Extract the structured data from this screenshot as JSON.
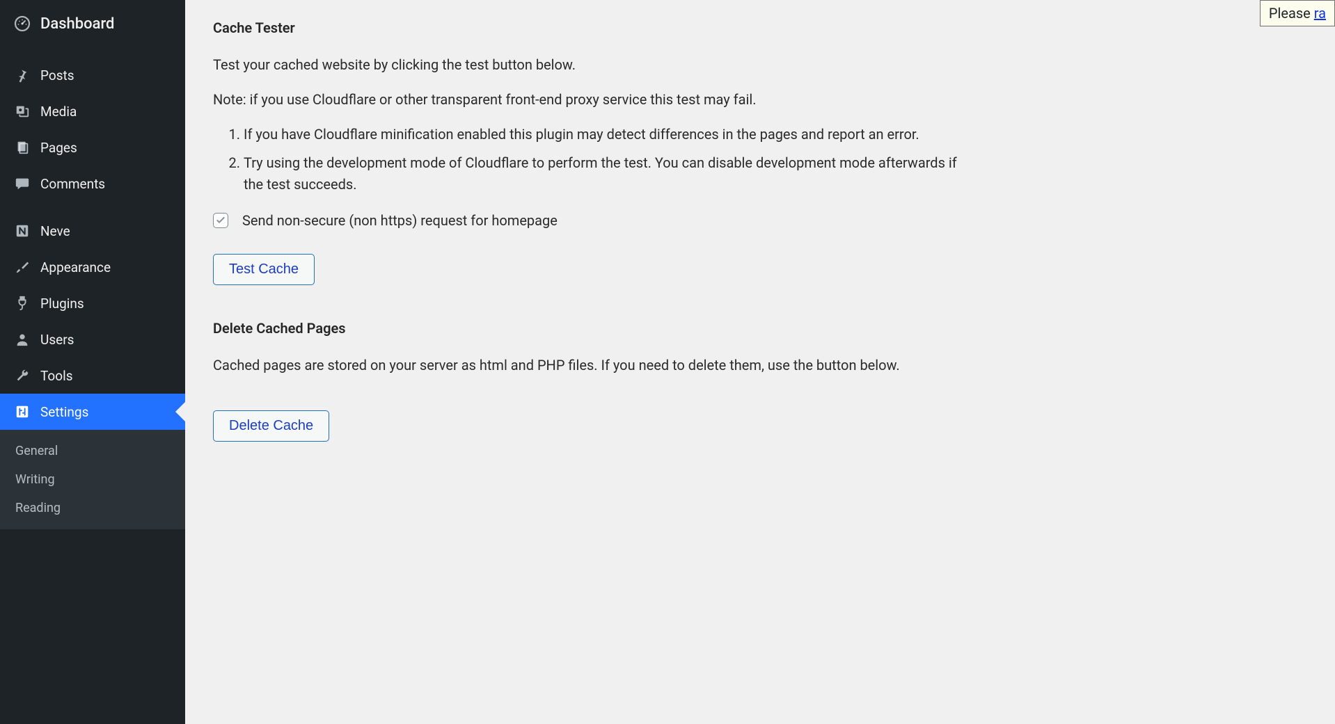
{
  "sidebar": {
    "items": [
      {
        "label": "Dashboard"
      },
      {
        "label": "Posts"
      },
      {
        "label": "Media"
      },
      {
        "label": "Pages"
      },
      {
        "label": "Comments"
      },
      {
        "label": "Neve"
      },
      {
        "label": "Appearance"
      },
      {
        "label": "Plugins"
      },
      {
        "label": "Users"
      },
      {
        "label": "Tools"
      },
      {
        "label": "Settings"
      }
    ],
    "submenu": [
      "General",
      "Writing",
      "Reading"
    ]
  },
  "notice": {
    "prefix": "Please ",
    "link": "ra"
  },
  "cache_tester": {
    "heading": "Cache Tester",
    "intro": "Test your cached website by clicking the test button below.",
    "note_intro": "Note: if you use Cloudflare or other transparent front-end proxy service this test may fail.",
    "note_items": [
      "If you have Cloudflare minification enabled this plugin may detect differences in the pages and report an error.",
      "Try using the development mode of Cloudflare to perform the test. You can disable development mode afterwards if the test succeeds."
    ],
    "checkbox_label": "Send non-secure (non https) request for homepage",
    "checkbox_checked": true,
    "test_button": "Test Cache"
  },
  "delete_cache": {
    "heading": "Delete Cached Pages",
    "intro": "Cached pages are stored on your server as html and PHP files. If you need to delete them, use the button below.",
    "button": "Delete Cache"
  }
}
